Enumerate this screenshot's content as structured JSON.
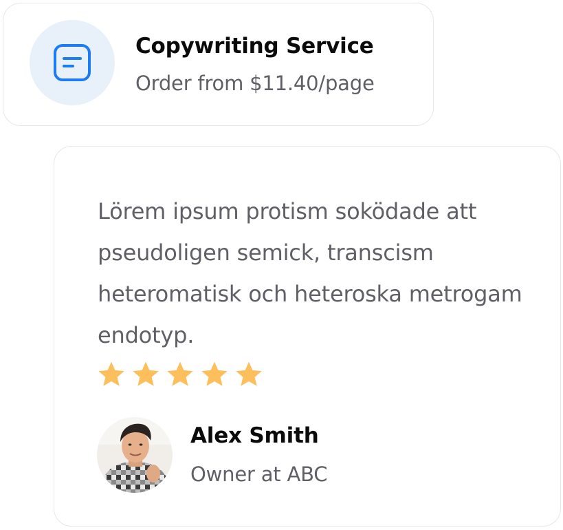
{
  "service": {
    "icon": "document-icon",
    "title": "Copywriting Service",
    "subtitle": "Order from $11.40/page"
  },
  "review": {
    "text": "Lörem ipsum protism soködade att pseudoligen semick, transcism heteromatisk och heteroska metrogam endotyp.",
    "rating": 5,
    "rating_max": 5,
    "author": {
      "name": "Alex Smith",
      "role": "Owner at ABC"
    }
  },
  "colors": {
    "accent": "#1d7cf2",
    "icon_background": "#e8f0fa",
    "star": "#fdbf5c",
    "heading": "#0b0b0b",
    "body_text": "#5f5f66",
    "border": "#e7e7ea"
  }
}
